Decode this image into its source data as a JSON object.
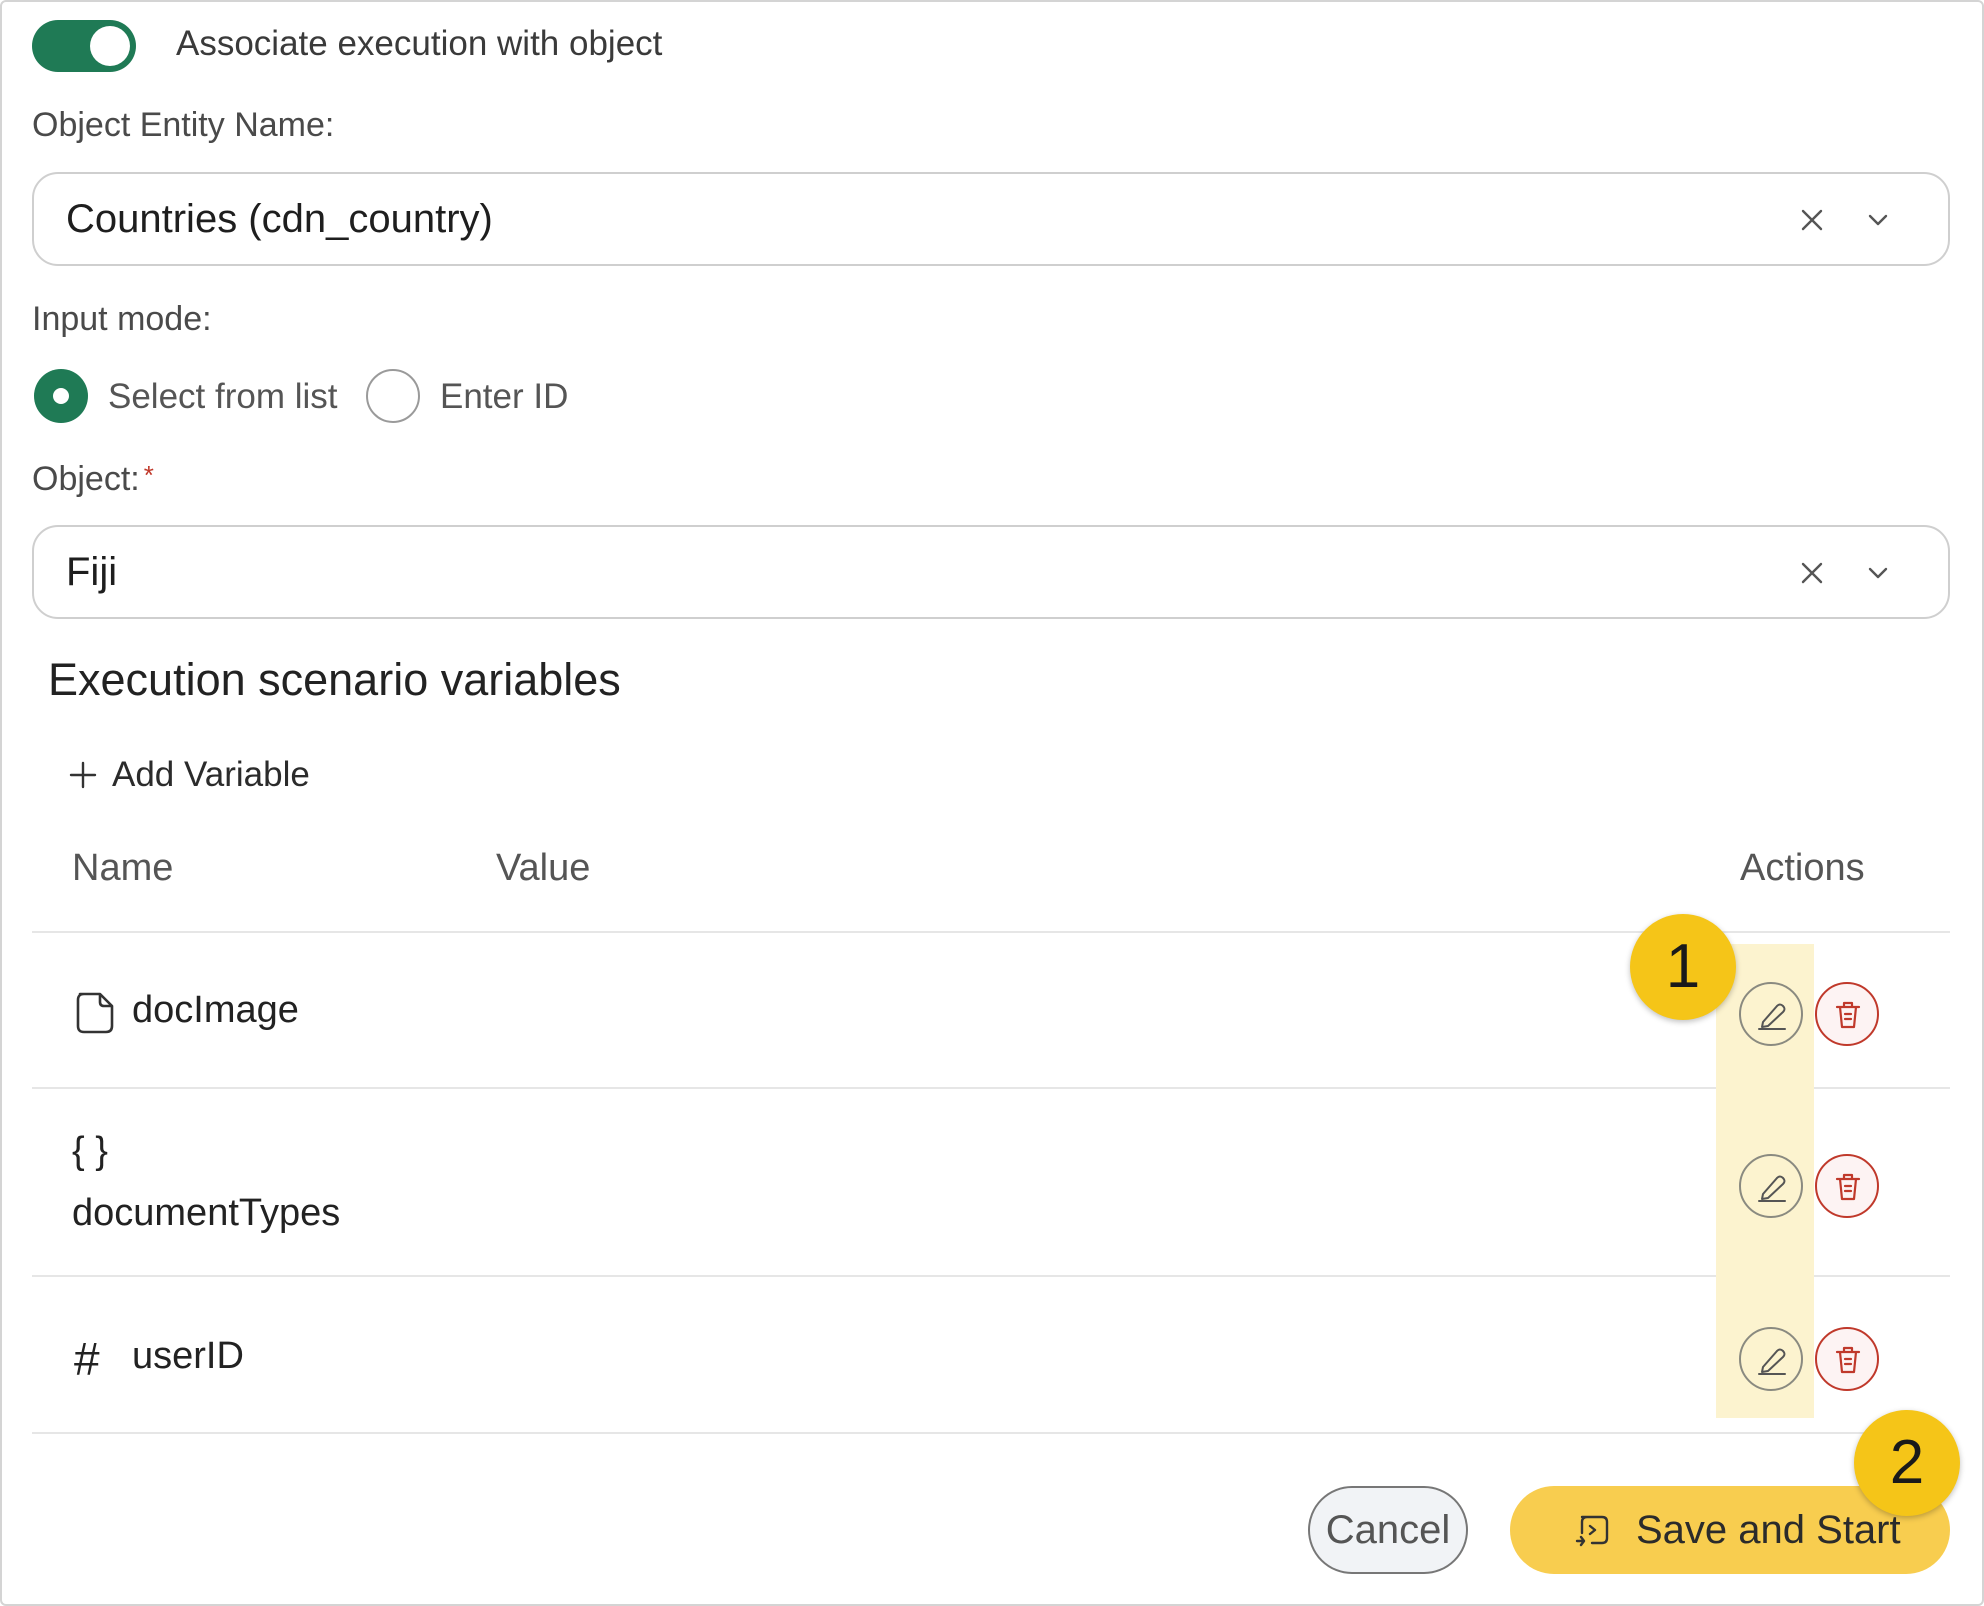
{
  "toggle": {
    "label": "Associate execution with object",
    "on": true
  },
  "entity": {
    "label": "Object Entity Name:",
    "value": "Countries (cdn_country)"
  },
  "input_mode": {
    "label": "Input mode:",
    "options": [
      "Select from list",
      "Enter ID"
    ],
    "selected": "Select from list"
  },
  "object": {
    "label": "Object:",
    "required_mark": "*",
    "value": "Fiji"
  },
  "variables": {
    "title": "Execution scenario variables",
    "add_label": "Add Variable",
    "columns": {
      "name": "Name",
      "value": "Value",
      "actions": "Actions"
    },
    "rows": [
      {
        "icon": "file-icon",
        "name": "docImage",
        "value": ""
      },
      {
        "icon": "braces-icon",
        "icon_text": "{ }",
        "name": "documentTypes",
        "value": ""
      },
      {
        "icon": "hash-icon",
        "icon_text": "#",
        "name": "userID",
        "value": ""
      }
    ]
  },
  "callouts": [
    "1",
    "2"
  ],
  "footer": {
    "cancel": "Cancel",
    "save": "Save and Start"
  },
  "colors": {
    "accent": "#1f7a55",
    "callout": "#f5c518",
    "save_button": "#f8cd4f",
    "delete": "#c0392b"
  }
}
